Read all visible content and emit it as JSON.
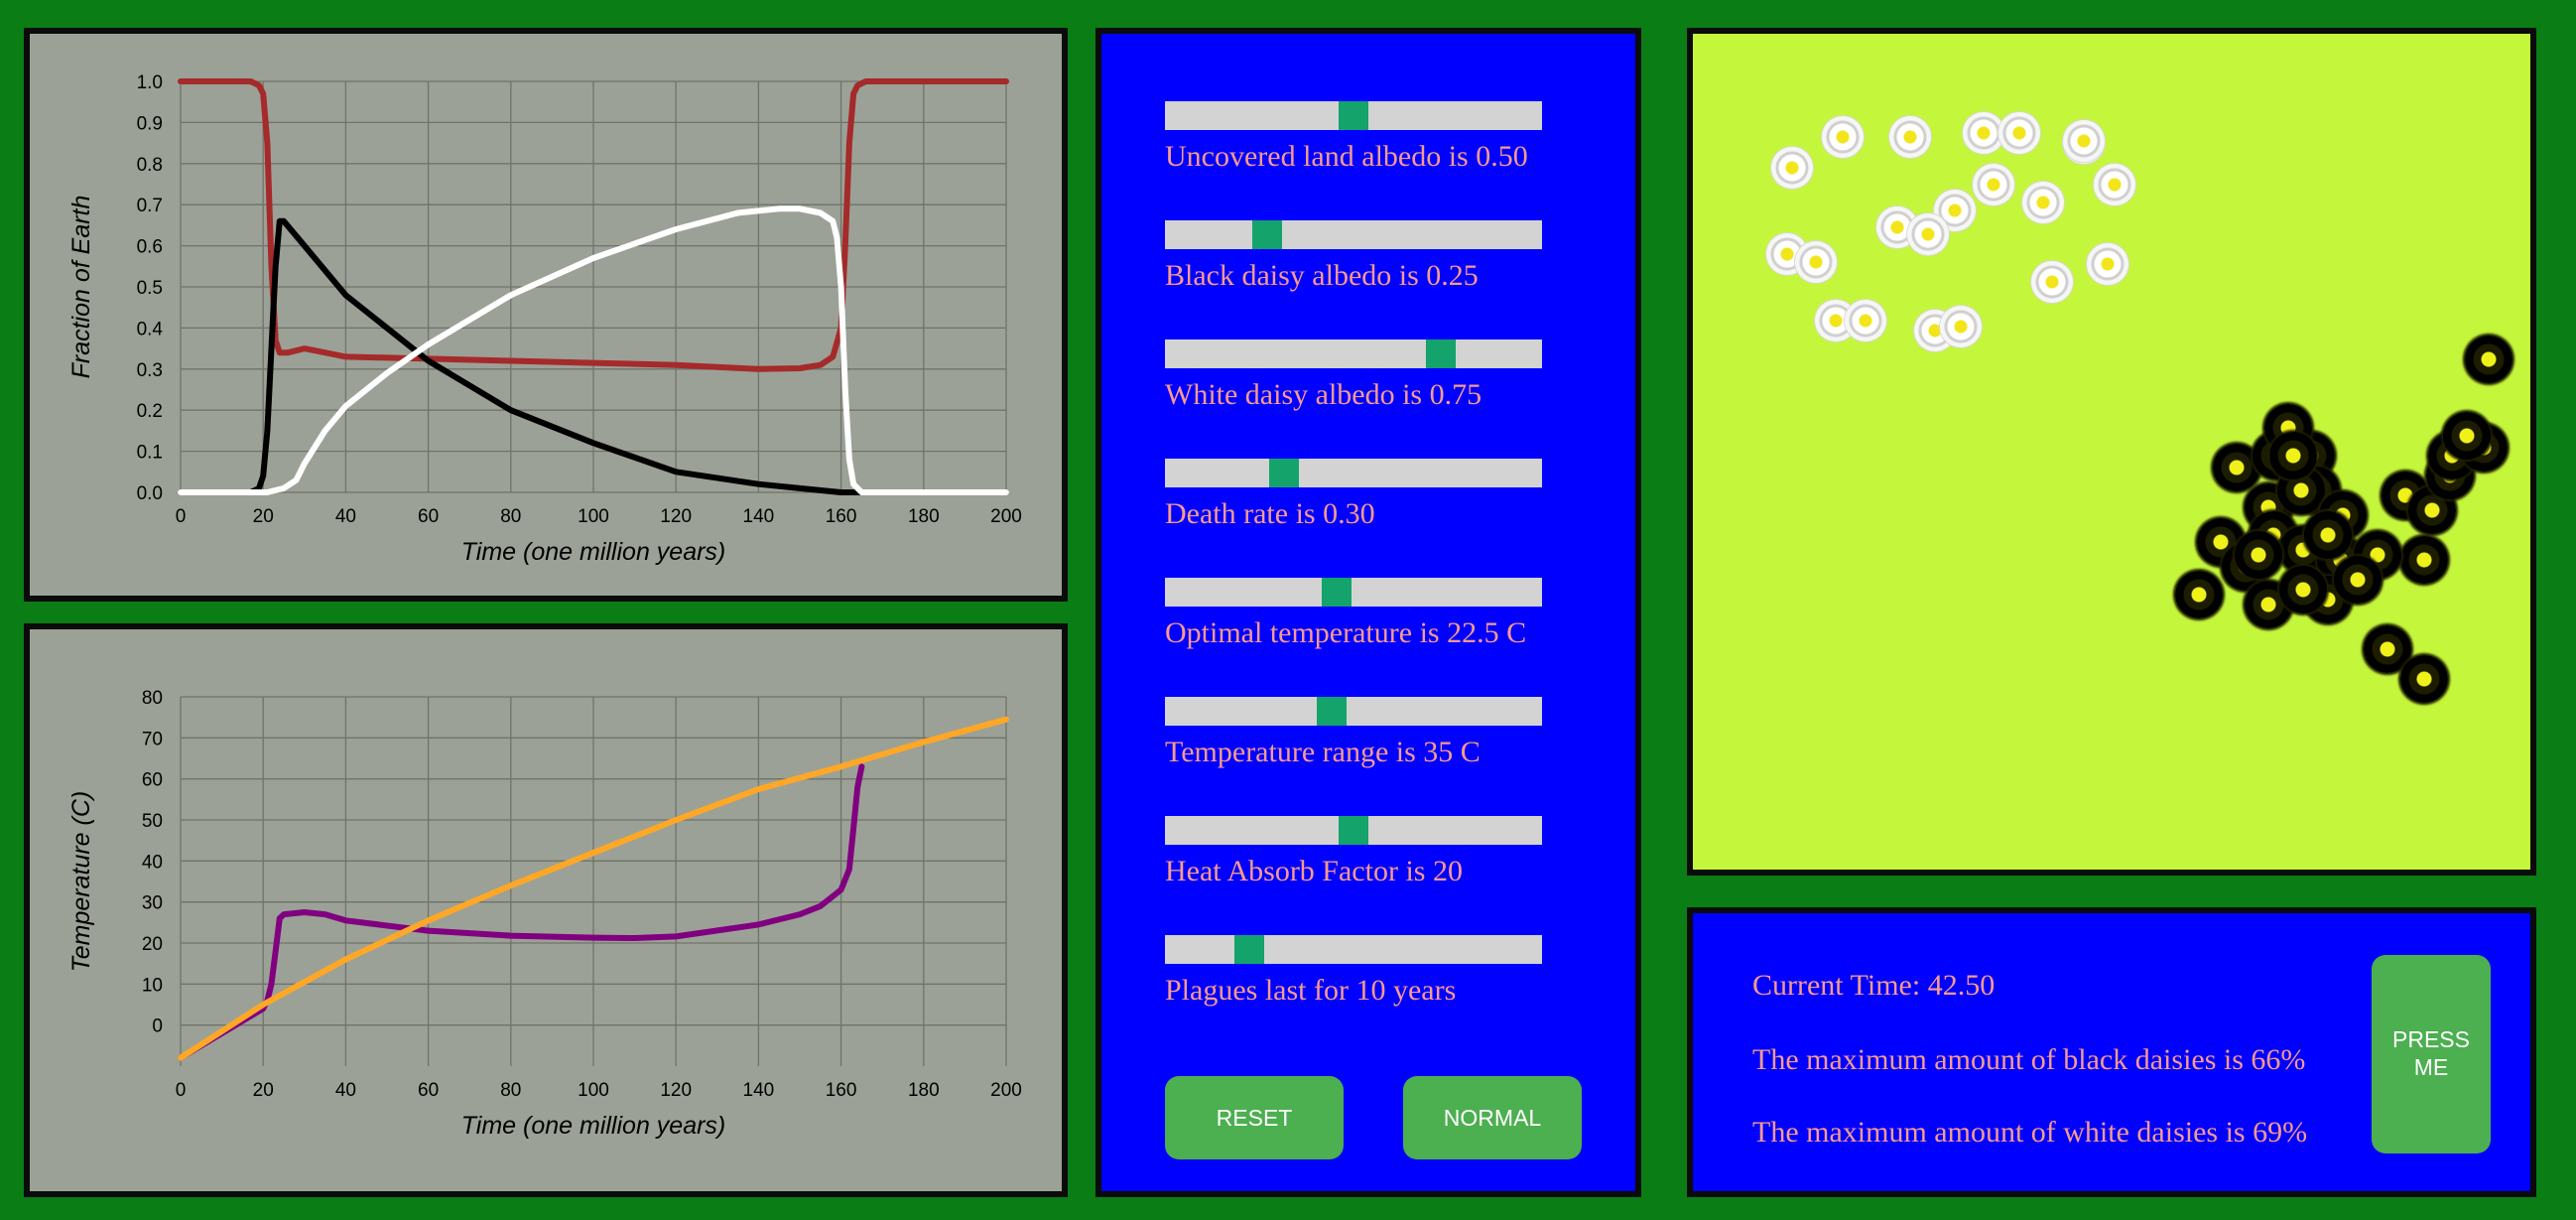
{
  "charts": [
    {
      "name": "daisy-fraction-chart",
      "ylabel": "Fraction of Earth",
      "xlabel": "Time (one million years)",
      "xticks": [
        "0",
        "20",
        "40",
        "60",
        "80",
        "100",
        "120",
        "140",
        "160",
        "180",
        "200"
      ],
      "yticks": [
        "0.0",
        "0.1",
        "0.2",
        "0.3",
        "0.4",
        "0.5",
        "0.6",
        "0.7",
        "0.8",
        "0.9",
        "1.0"
      ]
    },
    {
      "name": "temperature-chart",
      "ylabel": "Temperature (C)",
      "xlabel": "Time (one million years)",
      "xticks": [
        "0",
        "20",
        "40",
        "60",
        "80",
        "100",
        "120",
        "140",
        "160",
        "180",
        "200"
      ],
      "yticks": [
        "0",
        "10",
        "20",
        "30",
        "40",
        "50",
        "60",
        "70",
        "80"
      ]
    }
  ],
  "chart_data": [
    {
      "type": "line",
      "xlabel": "Time (one million years)",
      "ylabel": "Fraction of Earth",
      "xlim": [
        0,
        200
      ],
      "ylim": [
        0,
        1
      ],
      "grid": true,
      "series": [
        {
          "color": "#a52a2a",
          "x": [
            0,
            17,
            19,
            20,
            21,
            22,
            23,
            24,
            26,
            30,
            35,
            40,
            60,
            80,
            100,
            120,
            140,
            150,
            155,
            158,
            160,
            161,
            162,
            163,
            164,
            166,
            170,
            200
          ],
          "y": [
            1,
            1,
            0.99,
            0.97,
            0.85,
            0.55,
            0.37,
            0.34,
            0.34,
            0.35,
            0.34,
            0.33,
            0.325,
            0.32,
            0.315,
            0.31,
            0.3,
            0.302,
            0.31,
            0.33,
            0.4,
            0.6,
            0.85,
            0.97,
            0.99,
            1,
            1,
            1
          ]
        },
        {
          "color": "#000000",
          "x": [
            0,
            17,
            19,
            20,
            21,
            22,
            23,
            24,
            25,
            30,
            40,
            60,
            80,
            100,
            120,
            140,
            150,
            160,
            165,
            200
          ],
          "y": [
            0,
            0,
            0.01,
            0.04,
            0.15,
            0.35,
            0.55,
            0.66,
            0.66,
            0.6,
            0.48,
            0.32,
            0.2,
            0.12,
            0.05,
            0.02,
            0.01,
            0,
            0,
            0
          ]
        },
        {
          "color": "#ffffff",
          "x": [
            0,
            21,
            23,
            25,
            28,
            30,
            35,
            40,
            50,
            60,
            80,
            100,
            120,
            135,
            145,
            150,
            155,
            158,
            159,
            160,
            161,
            162,
            163,
            165,
            170,
            200
          ],
          "y": [
            0,
            0,
            0.005,
            0.01,
            0.03,
            0.07,
            0.15,
            0.21,
            0.29,
            0.36,
            0.48,
            0.57,
            0.64,
            0.68,
            0.69,
            0.69,
            0.68,
            0.66,
            0.62,
            0.5,
            0.25,
            0.08,
            0.02,
            0,
            0,
            0
          ]
        }
      ]
    },
    {
      "type": "line",
      "xlabel": "Time (one million years)",
      "ylabel": "Temperature (C)",
      "xlim": [
        0,
        200
      ],
      "ylim": [
        -10,
        80
      ],
      "grid": true,
      "series": [
        {
          "color": "#800080",
          "x": [
            0,
            10,
            20,
            21,
            22,
            23,
            24,
            25,
            30,
            35,
            40,
            60,
            80,
            100,
            110,
            120,
            140,
            150,
            155,
            160,
            162,
            163,
            164,
            165
          ],
          "y": [
            -8,
            -2,
            4,
            6,
            10,
            18,
            26,
            27,
            27.5,
            27,
            25.5,
            23,
            21.8,
            21.3,
            21.2,
            21.6,
            24.5,
            27,
            29,
            33,
            38,
            48,
            58,
            63
          ]
        },
        {
          "color": "#ffa726",
          "x": [
            0,
            20,
            40,
            60,
            80,
            100,
            120,
            140,
            160,
            180,
            200
          ],
          "y": [
            -8,
            5,
            16,
            25.5,
            34,
            42,
            50,
            57.5,
            63,
            69,
            74.5
          ]
        }
      ]
    }
  ],
  "sliders": [
    {
      "label": "Uncovered land albedo is 0.50",
      "value": 0.5,
      "min": 0,
      "max": 1
    },
    {
      "label": "Black daisy albedo is 0.25",
      "value": 0.25,
      "min": 0,
      "max": 1
    },
    {
      "label": "White daisy albedo is 0.75",
      "value": 0.75,
      "min": 0,
      "max": 1
    },
    {
      "label": "Death rate is 0.30",
      "value": 0.3,
      "min": 0,
      "max": 1
    },
    {
      "label": "Optimal temperature is 22.5 C",
      "value": 22.5,
      "min": 0,
      "max": 50
    },
    {
      "label": "Temperature range is 35 C",
      "value": 35,
      "min": 0,
      "max": 80
    },
    {
      "label": "Heat Absorb Factor is 20",
      "value": 20,
      "min": 0,
      "max": 40
    },
    {
      "label": "Plagues last for 10 years",
      "value": 10,
      "min": 0,
      "max": 50
    }
  ],
  "buttons": {
    "reset": "RESET",
    "normal": "NORMAL",
    "press": "PRESS ME"
  },
  "info": {
    "current_time": "Current Time: 42.50",
    "max_black": "The maximum amount of black daisies is 66%",
    "max_white": "The maximum amount of white daisies is 69%"
  },
  "colors": {
    "background": "#0a7d15",
    "control_panel": "#0000ff",
    "label_text": "#f79a8e",
    "slider_thumb": "#13a36b",
    "button": "#4caf50",
    "world": "#c4f63b"
  }
}
